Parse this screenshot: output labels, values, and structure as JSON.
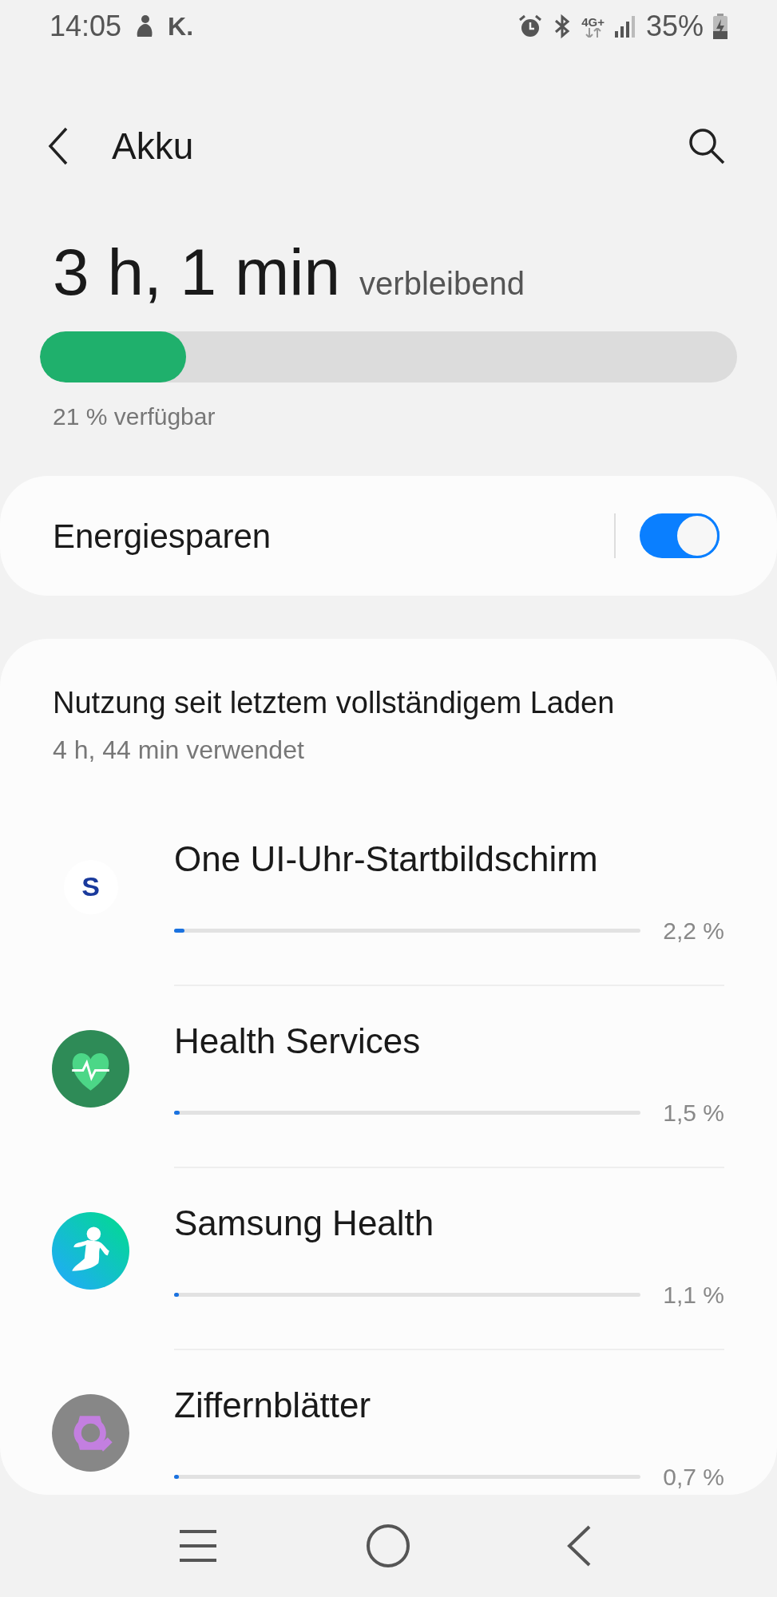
{
  "status_bar": {
    "time": "14:05",
    "notification_letter": "K.",
    "network": "4G+",
    "battery": "35%"
  },
  "header": {
    "title": "Akku"
  },
  "battery": {
    "remaining": "3 h, 1 min",
    "remaining_label": "verbleibend",
    "level": 0.21,
    "available": "21 % verfügbar"
  },
  "power_saving": {
    "label": "Energiesparen",
    "on": true
  },
  "usage": {
    "title": "Nutzung seit letztem vollständigem Laden",
    "subtitle": "4 h, 44 min verwendet",
    "apps": [
      {
        "kind": "letter",
        "icon_letter": "S",
        "name": "One UI-Uhr-Startbildschirm",
        "level": 0.022,
        "percent": "2,2 %"
      },
      {
        "kind": "heart",
        "name": "Health Services",
        "level": 0.012,
        "percent": "1,5 %"
      },
      {
        "kind": "runner",
        "name": "Samsung Health",
        "level": 0.01,
        "percent": "1,1 %"
      },
      {
        "kind": "watchface",
        "name": "Ziffernblätter",
        "level": 0.006,
        "percent": "0,7 %"
      }
    ]
  }
}
